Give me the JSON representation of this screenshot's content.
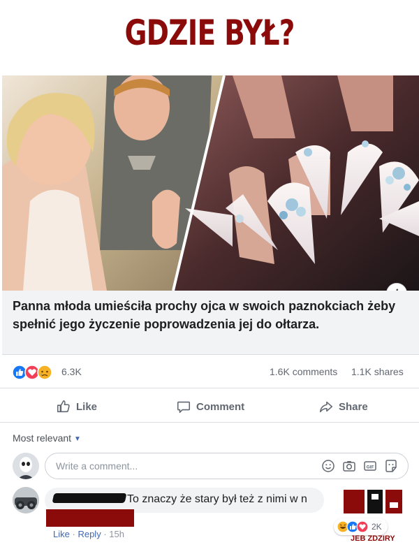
{
  "meme": {
    "title": "GDZIE BYŁ?"
  },
  "post": {
    "caption": "Panna młoda umieściła prochy ojca w swoich paznokciach żeby spełnić jego życzenie poprowadzenia jej do ołtarza.",
    "info_icon": "i"
  },
  "stats": {
    "reaction_count": "6.3K",
    "comments": "1.6K comments",
    "shares": "1.1K shares",
    "reaction_icons": [
      "like-icon",
      "love-icon",
      "sad-icon"
    ]
  },
  "actions": {
    "like": "Like",
    "comment": "Comment",
    "share": "Share"
  },
  "comments_section": {
    "sort_label": "Most relevant",
    "write_placeholder": "Write a comment...",
    "input_icons": [
      "emoji-icon",
      "camera-icon",
      "gif-icon",
      "sticker-icon"
    ],
    "comment": {
      "text": "To znaczy że stary był też z nimi w n",
      "like": "Like",
      "reply": "Reply",
      "separator": "·",
      "time": "15h",
      "reaction_count": "2K",
      "reaction_icons": [
        "haha-icon",
        "like-icon",
        "love-icon"
      ]
    }
  },
  "watermark": {
    "text": "JEB ZDZIRY"
  },
  "colors": {
    "title": "#8b0a0a",
    "fb_blue": "#4267b2",
    "muted": "#606770"
  }
}
